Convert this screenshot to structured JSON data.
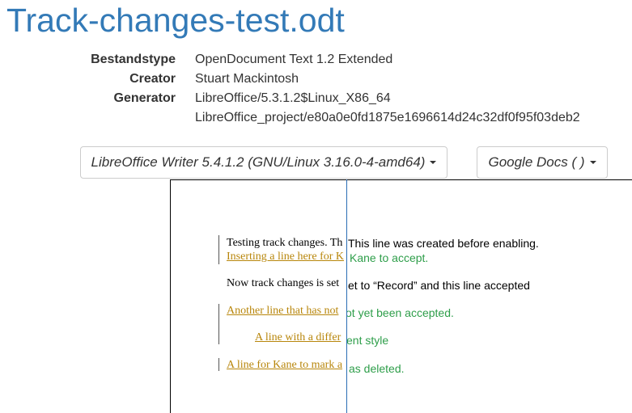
{
  "page_title": "Track-changes-test.odt",
  "metadata": [
    {
      "key": "Bestandstype",
      "value": "OpenDocument Text 1.2 Extended"
    },
    {
      "key": "Creator",
      "value": "Stuart Mackintosh"
    },
    {
      "key": "Generator",
      "value": "LibreOffice/5.3.1.2$Linux_X86_64"
    },
    {
      "key": "",
      "value": "LibreOffice_project/e80a0e0fd1875e1696614d24c32df0f95f03deb2"
    }
  ],
  "renderer_left": {
    "label": "LibreOffice Writer 5.4.1.2 (GNU/Linux 3.16.0-4-amd64)"
  },
  "renderer_right": {
    "label": "Google Docs ( )"
  },
  "left_doc": {
    "lines": [
      "Testing track changes. Th",
      "Inserting a line here for K",
      "Now track changes is set",
      "Another line that has not",
      "A line with a differ",
      "A line for Kane to mark a"
    ]
  },
  "right_doc": {
    "lines": [
      "This line was created before enabling.",
      "Kane to accept.",
      "et to “Record” and this line accepted",
      "ot yet been accepted.",
      "ent style",
      "as deleted."
    ]
  },
  "colors": {
    "title": "#337ab7",
    "tracked_change": "#b8860b",
    "gd_insert": "#2e9e4a",
    "divider": "#2a6db5"
  }
}
